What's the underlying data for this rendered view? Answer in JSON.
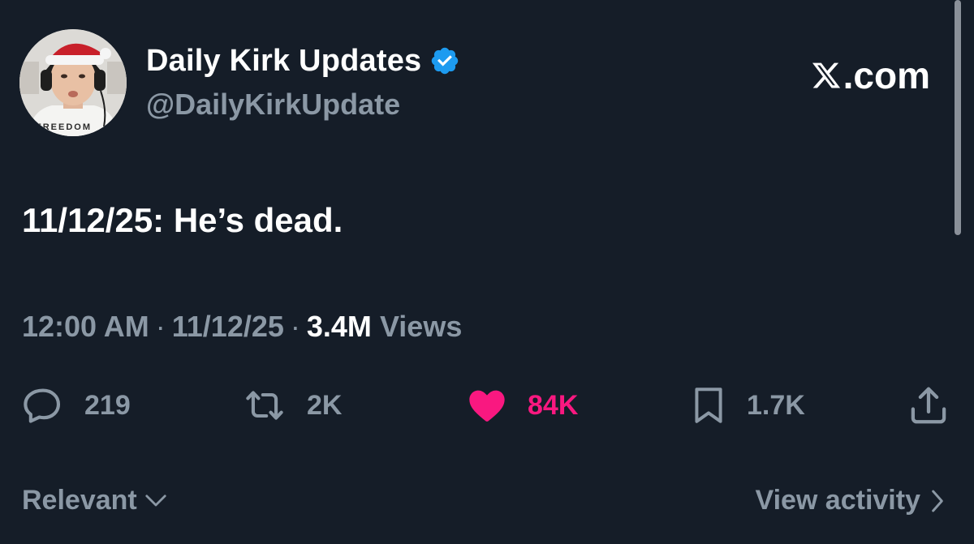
{
  "author": {
    "display_name": "Daily Kirk Updates",
    "handle": "@DailyKirkUpdate",
    "verified": true,
    "avatar_shirt_text": "FREEDOM"
  },
  "brand": {
    "text": ".com",
    "logo": "x-logo-icon"
  },
  "tweet": {
    "text": "11/12/25: He’s dead."
  },
  "meta": {
    "time": "12:00 AM",
    "separator": "·",
    "date": "11/12/25",
    "views_count": "3.4M",
    "views_label": "Views"
  },
  "actions": {
    "replies": "219",
    "reposts": "2K",
    "likes": "84K",
    "bookmarks": "1.7K"
  },
  "footer": {
    "sort_label": "Relevant",
    "view_activity": "View activity"
  },
  "colors": {
    "background": "#151d28",
    "text_primary": "#ffffff",
    "text_secondary": "#8b98a5",
    "like_pink": "#f91880",
    "verified_blue": "#1d9bf0"
  }
}
